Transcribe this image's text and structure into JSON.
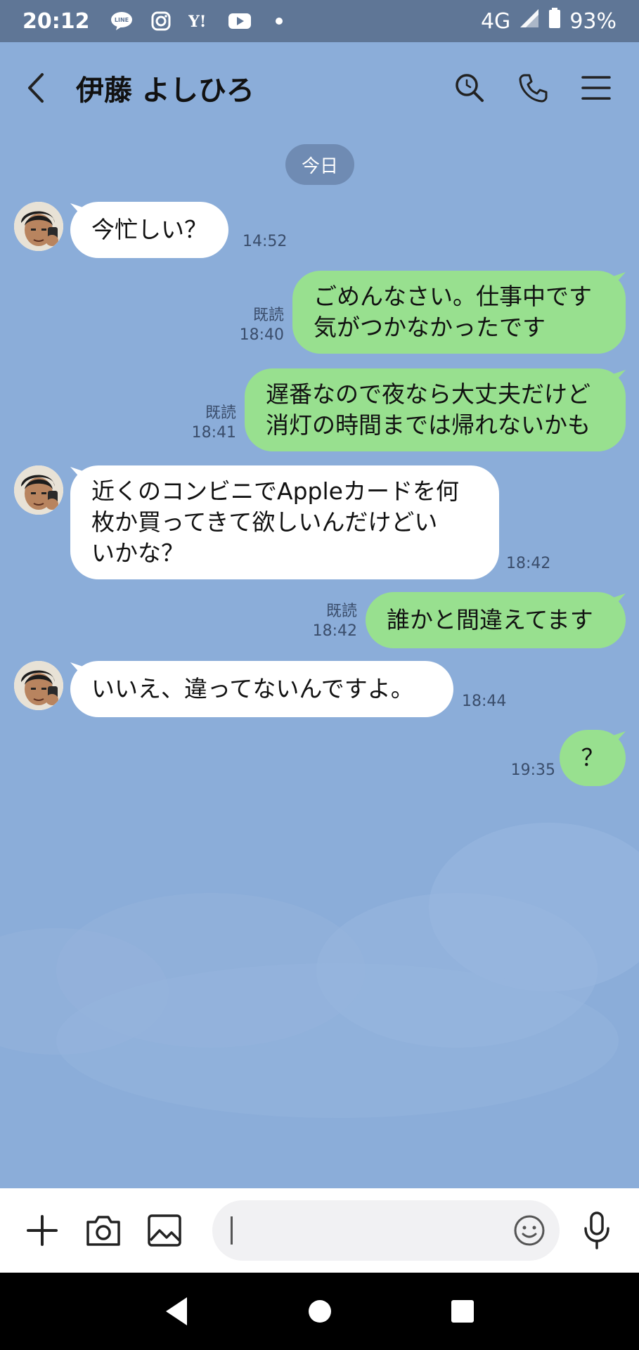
{
  "status_bar": {
    "time": "20:12",
    "network": "4G",
    "battery": "93%",
    "notification_icons": [
      "line-icon",
      "instagram-icon",
      "yahoo-icon",
      "youtube-icon",
      "dot-icon"
    ]
  },
  "header": {
    "title": "伊藤 よしひろ",
    "icons": [
      "back-icon",
      "search-icon",
      "phone-icon",
      "menu-icon"
    ]
  },
  "date_separator": "今日",
  "messages": [
    {
      "side": "in",
      "text": "今忙しい？",
      "time": "14:52"
    },
    {
      "side": "out",
      "text": "ごめんなさい。仕事中です\n気がつかなかったです",
      "read": "既読",
      "time": "18:40"
    },
    {
      "side": "out",
      "text": "遅番なので夜なら大丈夫だけど\n消灯の時間までは帰れないかも",
      "read": "既読",
      "time": "18:41"
    },
    {
      "side": "in",
      "text": "近くのコンビニでAppleカードを何\n枚か買ってきて欲しいんだけどい\nいかな？",
      "time": "18:42"
    },
    {
      "side": "out",
      "text": "誰かと間違えてます",
      "read": "既読",
      "time": "18:42"
    },
    {
      "side": "in",
      "text": "いいえ、違ってないんですよ。",
      "time": "18:44"
    },
    {
      "side": "out",
      "text": "？",
      "time": "19:35"
    }
  ],
  "input_bar": {
    "icons": [
      "plus-icon",
      "camera-icon",
      "image-icon",
      "emoji-icon",
      "mic-icon"
    ]
  },
  "colors": {
    "background": "#8badd9",
    "status_bar": "#5f7696",
    "incoming_bubble": "#ffffff",
    "outgoing_bubble": "#98e08f"
  }
}
